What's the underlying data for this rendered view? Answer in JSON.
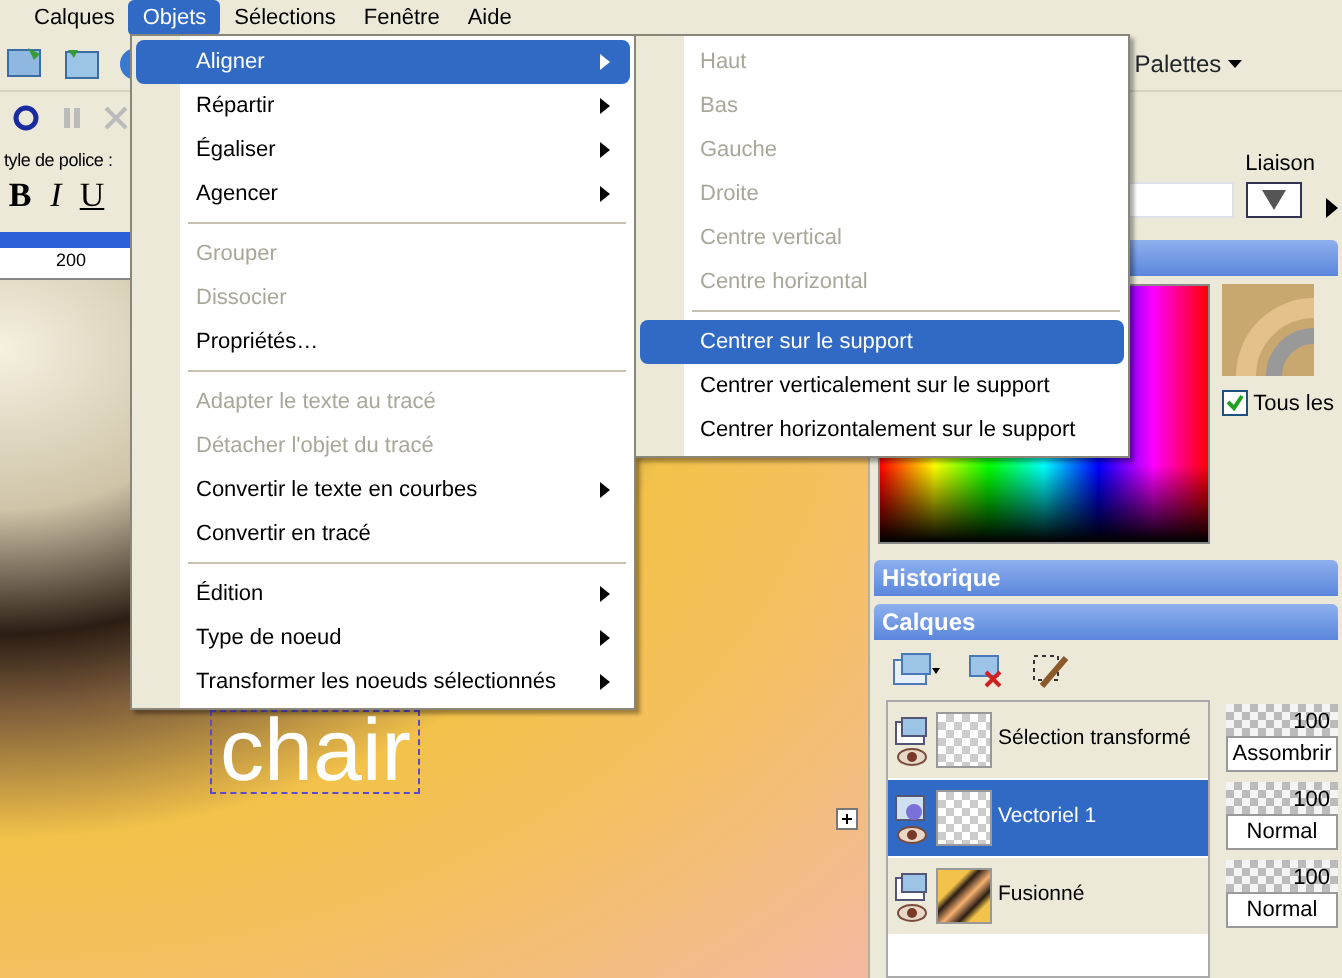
{
  "menubar": [
    {
      "label": "Calques",
      "selected": false
    },
    {
      "label": "Objets",
      "selected": true
    },
    {
      "label": "Sélections",
      "selected": false
    },
    {
      "label": "Fenêtre",
      "selected": false
    },
    {
      "label": "Aide",
      "selected": false
    }
  ],
  "toolbar": {
    "palettes_button": "Palettes"
  },
  "text_options": {
    "font_style_label": "tyle de police :",
    "style_buttons": [
      "B",
      "I",
      "U"
    ],
    "link_label": "Liaison"
  },
  "ruler": {
    "mark": "200"
  },
  "canvas": {
    "text_object": "chair"
  },
  "menu": [
    {
      "kind": "item",
      "label": "Aligner",
      "disabled": false,
      "submenu": true,
      "selected": true
    },
    {
      "kind": "item",
      "label": "Répartir",
      "disabled": false,
      "submenu": true,
      "selected": false
    },
    {
      "kind": "item",
      "label": "Égaliser",
      "disabled": false,
      "submenu": true,
      "selected": false
    },
    {
      "kind": "item",
      "label": "Agencer",
      "disabled": false,
      "submenu": true,
      "selected": false
    },
    {
      "kind": "separator"
    },
    {
      "kind": "item",
      "label": "Grouper",
      "disabled": true,
      "submenu": false,
      "selected": false
    },
    {
      "kind": "item",
      "label": "Dissocier",
      "disabled": true,
      "submenu": false,
      "selected": false
    },
    {
      "kind": "item",
      "label": "Propriétés…",
      "disabled": false,
      "submenu": false,
      "selected": false
    },
    {
      "kind": "separator"
    },
    {
      "kind": "item",
      "label": "Adapter le texte au tracé",
      "disabled": true,
      "submenu": false,
      "selected": false
    },
    {
      "kind": "item",
      "label": "Détacher l'objet du tracé",
      "disabled": true,
      "submenu": false,
      "selected": false
    },
    {
      "kind": "item",
      "label": "Convertir le texte en courbes",
      "disabled": false,
      "submenu": true,
      "selected": false
    },
    {
      "kind": "item",
      "label": "Convertir en tracé",
      "disabled": false,
      "submenu": false,
      "selected": false
    },
    {
      "kind": "separator"
    },
    {
      "kind": "item",
      "label": "Édition",
      "disabled": false,
      "submenu": true,
      "selected": false
    },
    {
      "kind": "item",
      "label": "Type de noeud",
      "disabled": false,
      "submenu": true,
      "selected": false
    },
    {
      "kind": "item",
      "label": "Transformer les noeuds sélectionnés",
      "disabled": false,
      "submenu": true,
      "selected": false
    }
  ],
  "submenu": [
    {
      "kind": "item",
      "label": "Haut",
      "disabled": true,
      "selected": false
    },
    {
      "kind": "item",
      "label": "Bas",
      "disabled": true,
      "selected": false
    },
    {
      "kind": "item",
      "label": "Gauche",
      "disabled": true,
      "selected": false
    },
    {
      "kind": "item",
      "label": "Droite",
      "disabled": true,
      "selected": false
    },
    {
      "kind": "item",
      "label": "Centre vertical",
      "disabled": true,
      "selected": false
    },
    {
      "kind": "item",
      "label": "Centre horizontal",
      "disabled": true,
      "selected": false
    },
    {
      "kind": "separator"
    },
    {
      "kind": "item",
      "label": "Centrer sur le support",
      "disabled": false,
      "selected": true
    },
    {
      "kind": "item",
      "label": "Centrer verticalement sur le support",
      "disabled": false,
      "selected": false
    },
    {
      "kind": "item",
      "label": "Centrer horizontalement sur le support",
      "disabled": false,
      "selected": false
    }
  ],
  "materials": {
    "all_tools_checkbox": {
      "label": "Tous les",
      "checked": true
    }
  },
  "history_panel": {
    "title": "Historique"
  },
  "layers_panel": {
    "title": "Calques",
    "layers": [
      {
        "name": "Sélection transformé",
        "selected": false,
        "kind": "raster",
        "opacity": "100",
        "level": 1,
        "blend": "Assombrir"
      },
      {
        "name": "Vectoriel 1",
        "selected": true,
        "kind": "vector",
        "expanded": false,
        "opacity": "100",
        "level": 1,
        "blend": "Normal"
      },
      {
        "name": "Fusionné",
        "selected": false,
        "kind": "raster",
        "opacity": "100",
        "level": 1,
        "blend": "Normal"
      }
    ]
  }
}
